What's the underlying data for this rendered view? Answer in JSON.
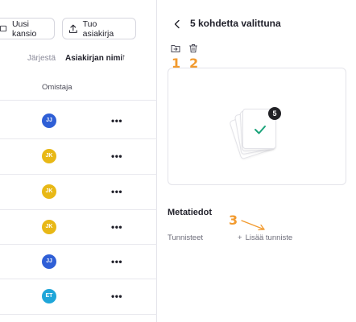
{
  "toolbar": {
    "new_folder_label": "Uusi kansio",
    "import_label": "Tuo asiakirja"
  },
  "sort": {
    "label": "Järjestä",
    "value": "Asiakirjan nimi",
    "arrow": "↑"
  },
  "table": {
    "owner_header": "Omistaja",
    "more_label": "•••",
    "rows": [
      {
        "initials": "JJ",
        "color": "#2f5fd6"
      },
      {
        "initials": "JK",
        "color": "#e8b816"
      },
      {
        "initials": "JK",
        "color": "#e8b816"
      },
      {
        "initials": "JK",
        "color": "#e8b816"
      },
      {
        "initials": "JJ",
        "color": "#2f5fd6"
      },
      {
        "initials": "ET",
        "color": "#1fa6d9"
      }
    ]
  },
  "details": {
    "title": "5 kohdetta valittuna",
    "selected_count": "5",
    "annotations": {
      "one": "1",
      "two": "2",
      "three": "3"
    },
    "metadata_title": "Metatiedot",
    "tags_label": "Tunnisteet",
    "add_tag_plus": "+",
    "add_tag_label": "Lisää tunniste"
  },
  "colors": {
    "annotation": "#f29a2e",
    "check": "#1aa37a",
    "badge": "#222226"
  }
}
